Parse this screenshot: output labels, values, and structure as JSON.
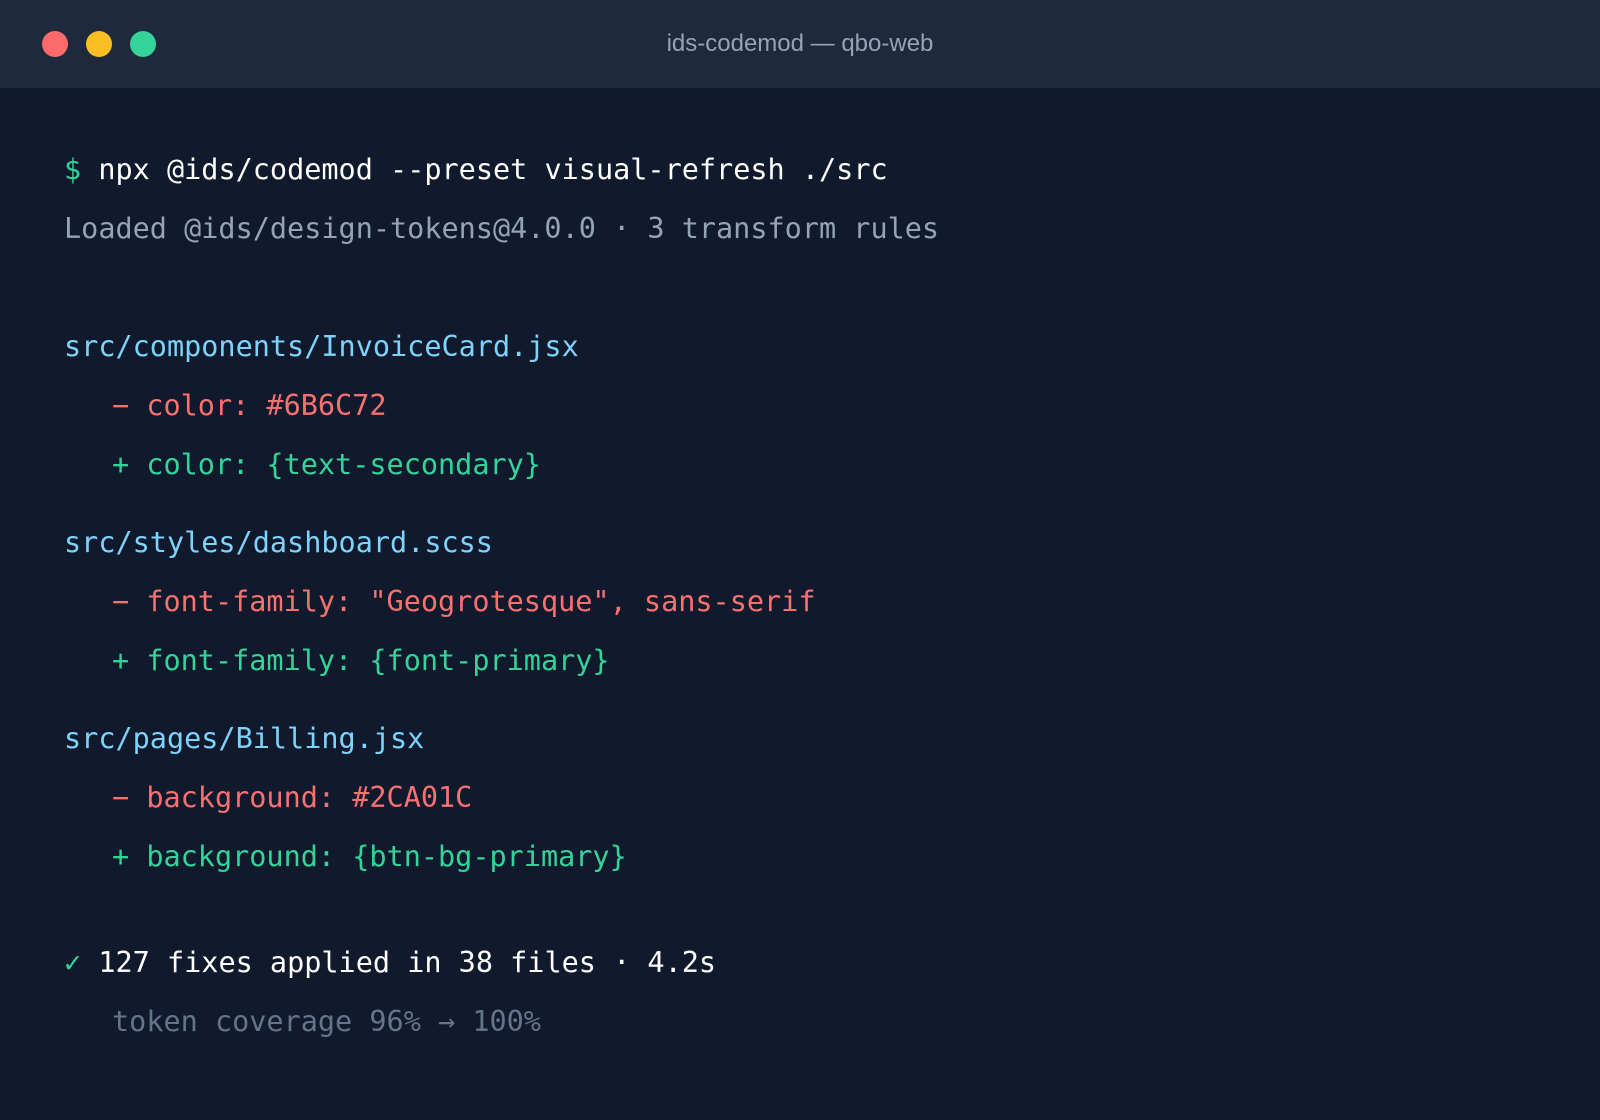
{
  "window": {
    "title": "ids-codemod — qbo-web",
    "traffic_lights": {
      "close_color": "#ff6b6b",
      "minimize_color": "#fbbf24",
      "maximize_color": "#34d399"
    }
  },
  "terminal": {
    "prompt_symbol": "$",
    "command": "npx @ids/codemod --preset visual-refresh ./src",
    "loaded_message": "Loaded @ids/design-tokens@4.0.0 · 3 transform rules",
    "files": [
      {
        "path": "src/components/InvoiceCard.jsx",
        "removed": "− color: #6B6C72",
        "added": "+ color: {text-secondary}"
      },
      {
        "path": "src/styles/dashboard.scss",
        "removed": "− font-family: \"Geogrotesque\", sans-serif",
        "added": "+ font-family: {font-primary}"
      },
      {
        "path": "src/pages/Billing.jsx",
        "removed": "− background: #2CA01C",
        "added": "+ background: {btn-bg-primary}"
      }
    ],
    "summary_check": "✓",
    "summary": "127 fixes applied in 38 files · 4.2s",
    "coverage": "token coverage 96% → 100%"
  },
  "colors": {
    "background": "#111a2c",
    "titlebar": "#1e293b",
    "file_path": "#7dd3fc",
    "removed": "#f87171",
    "added": "#34d399"
  }
}
